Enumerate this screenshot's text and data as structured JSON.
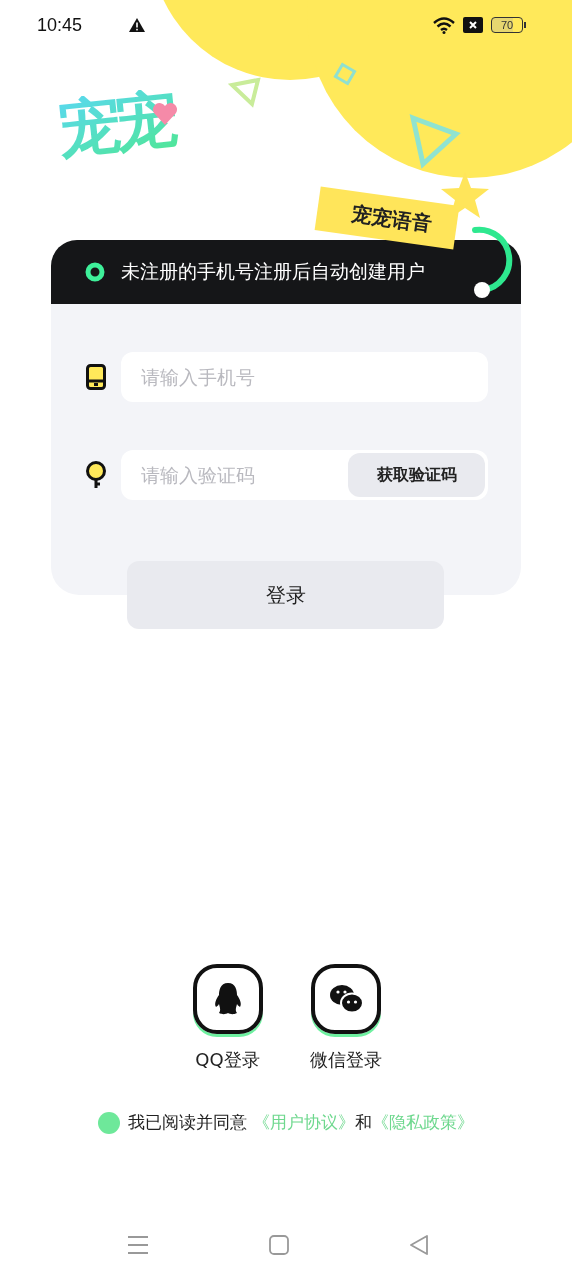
{
  "status_bar": {
    "time": "10:45",
    "battery": "70"
  },
  "logo": {
    "text": "宠宠"
  },
  "tag": {
    "text": "宠宠语音"
  },
  "notice": {
    "text": "未注册的手机号注册后自动创建用户"
  },
  "fields": [
    {
      "kind": "phone",
      "placeholder": "请输入手机号"
    },
    {
      "kind": "code",
      "placeholder": "请输入验证码",
      "button": "获取验证码"
    }
  ],
  "login_button": "登录",
  "social_logins": [
    {
      "kind": "qq",
      "label": "QQ登录"
    },
    {
      "kind": "wechat",
      "label": "微信登录"
    }
  ],
  "agreement": {
    "checked": true,
    "text": "我已阅读并同意",
    "link_1": "《用户协议》",
    "conjunction": "和",
    "link_2": "《隐私政策》"
  }
}
